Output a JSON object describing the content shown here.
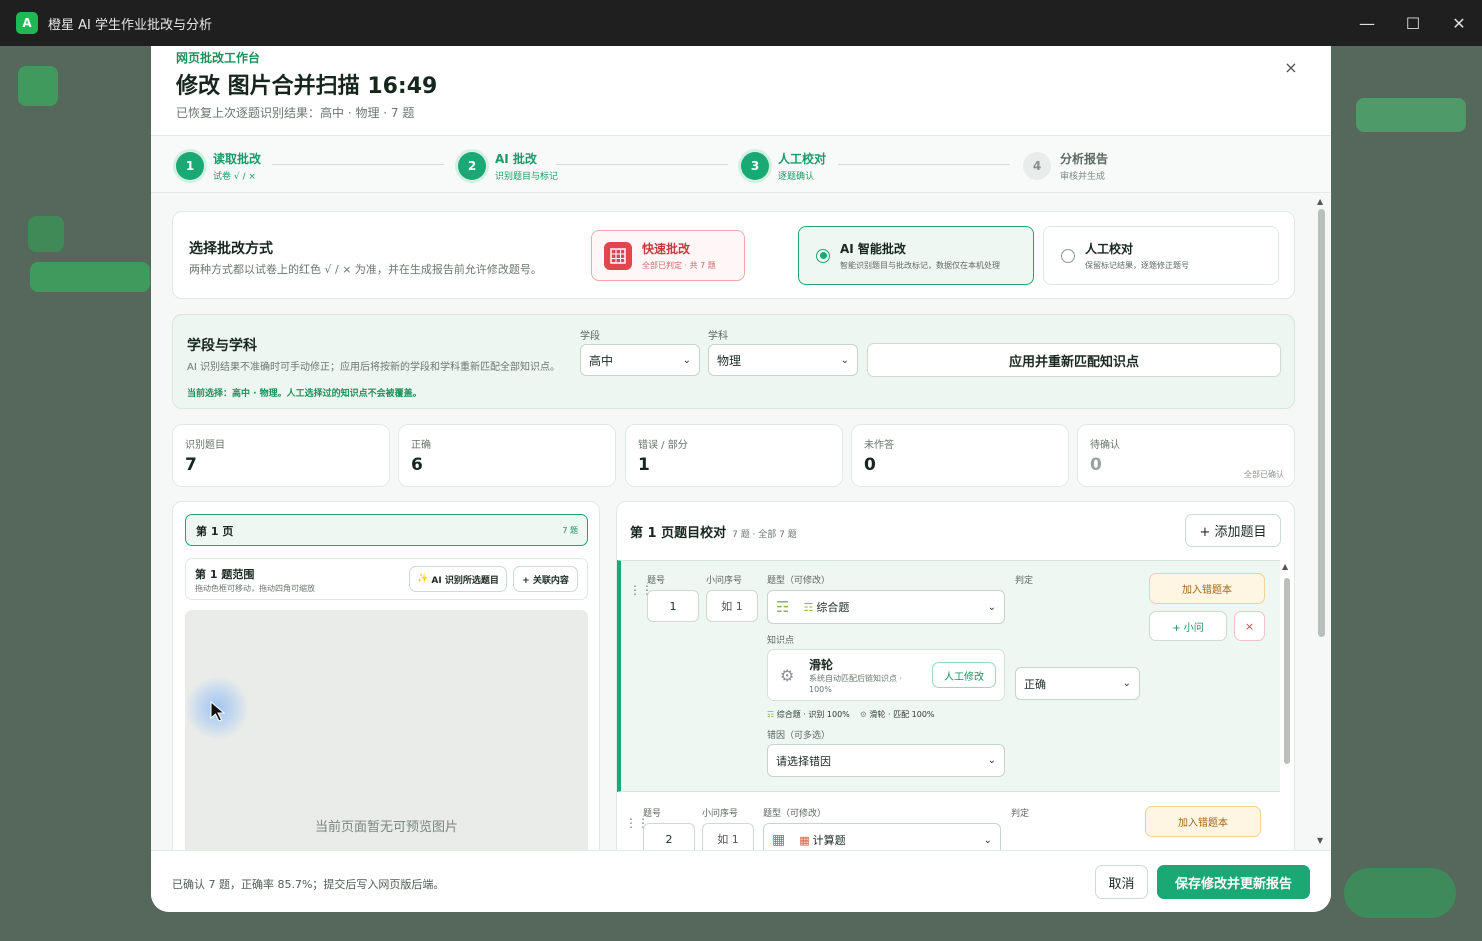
{
  "window": {
    "title": "橙星 AI 学生作业批改与分析",
    "icon_glyph": "A"
  },
  "modal": {
    "eyebrow": "网页批改工作台",
    "title": "修改 图片合并扫描 16:49",
    "subtitle": "已恢复上次逐题识别结果：高中 · 物理 · 7 题",
    "close_label": "×"
  },
  "steps": [
    {
      "num": "1",
      "title": "读取批改",
      "desc": "试卷 √ / ×"
    },
    {
      "num": "2",
      "title": "AI 批改",
      "desc": "识别题目与标记"
    },
    {
      "num": "3",
      "title": "人工校对",
      "desc": "逐题确认"
    },
    {
      "num": "4",
      "title": "分析报告",
      "desc": "审核并生成"
    }
  ],
  "mode": {
    "heading": "选择批改方式",
    "desc": "两种方式都以试卷上的红色 √ / × 为准，并在生成报告前允许修改题号。",
    "options": [
      {
        "title": "快速批改",
        "desc": "全部已判定 · 共 7 题"
      },
      {
        "title": "AI 智能批改",
        "desc": "智能识别题目与批改标记，数据仅在本机处理"
      },
      {
        "title": "人工校对",
        "desc": "保留标记结果，逐题修正题号"
      }
    ]
  },
  "subject": {
    "heading": "学段与学科",
    "desc": "AI 识别结果不准确时可手动修正；应用后将按新的学段和学科重新匹配全部知识点。",
    "note": "当前选择：高中 · 物理。人工选择过的知识点不会被覆盖。",
    "stage_label": "学段",
    "stage_value": "高中",
    "subject_label": "学科",
    "subject_value": "物理",
    "apply_label": "应用并重新匹配知识点"
  },
  "stats": [
    {
      "label": "识别题目",
      "value": "7"
    },
    {
      "label": "正确",
      "value": "6"
    },
    {
      "label": "错误 / 部分",
      "value": "1"
    },
    {
      "label": "未作答",
      "value": "0"
    },
    {
      "label": "待确认",
      "value": "0",
      "note": "全部已确认"
    }
  ],
  "left_panel": {
    "page_tab": "第 1 页",
    "page_count": "7 题",
    "range_title": "第 1 题范围",
    "range_desc": "拖动色框可移动，拖动四角可缩放",
    "ai_btn": "AI 识别所选题目",
    "link_btn": "+ 关联内容",
    "empty_preview": "当前页面暂无可预览图片"
  },
  "right_panel": {
    "title": "第 1 页题目校对",
    "meta": "7 题 · 全部 7 题",
    "add_btn": "+ 添加题目",
    "labels": {
      "num": "题号",
      "sub": "小问序号",
      "type": "题型（可修改）",
      "judge": "判定",
      "kp": "知识点",
      "cause": "错因（可多选）"
    },
    "q1": {
      "num": "1",
      "sub": "如 1",
      "type": "综合题",
      "kp_name": "滑轮",
      "kp_desc": "系统自动匹配后链知识点 · 100%",
      "kp_btn": "人工修改",
      "tag1": "综合题 · 识别 100%",
      "tag2": "滑轮 · 匹配 100%",
      "cause_placeholder": "请选择错因",
      "judge": "正确",
      "wrongbook_btn": "加入错题本",
      "sub_btn": "+ 小问",
      "del_btn": "×"
    },
    "q2": {
      "num": "2",
      "sub": "如 1",
      "type": "计算题",
      "wrongbook_btn": "加入错题本"
    }
  },
  "footer": {
    "summary": "已确认 7 题，正确率 85.7%；提交后写入网页版后端。",
    "cancel": "取消",
    "save": "保存修改并更新报告"
  },
  "colors": {
    "accent": "#1aa874",
    "warn": "#e0464b",
    "wrongbook": "#fff5e3"
  }
}
